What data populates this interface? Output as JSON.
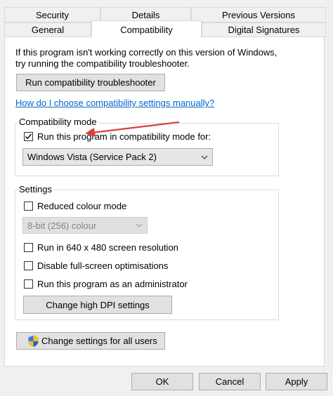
{
  "tabs": {
    "row1": [
      "Security",
      "Details",
      "Previous Versions"
    ],
    "row2": [
      "General",
      "Compatibility",
      "Digital Signatures"
    ]
  },
  "intro": {
    "line1": "If this program isn't working correctly on this version of Windows,",
    "line2": "try running the compatibility troubleshooter."
  },
  "troubleshooter_button": "Run compatibility troubleshooter",
  "manual_link": "How do I choose compatibility settings manually?",
  "compat_mode": {
    "group_label": "Compatibility mode",
    "checkbox_label": "Run this program in compatibility mode for:",
    "checked": true,
    "selected_os": "Windows Vista (Service Pack 2)"
  },
  "settings": {
    "group_label": "Settings",
    "reduced_colour": "Reduced colour mode",
    "colour_option": "8-bit (256) colour",
    "res_640": "Run in 640 x 480 screen resolution",
    "disable_fullscreen": "Disable full-screen optimisations",
    "run_admin": "Run this program as an administrator",
    "dpi_button": "Change high DPI settings"
  },
  "all_users_button": "Change settings for all users",
  "footer": {
    "ok": "OK",
    "cancel": "Cancel",
    "apply": "Apply"
  },
  "colors": {
    "link": "#0066cc",
    "annotation_arrow": "#d9413c",
    "check": "#000000"
  },
  "icons": {
    "shield": "uac-shield-icon"
  }
}
